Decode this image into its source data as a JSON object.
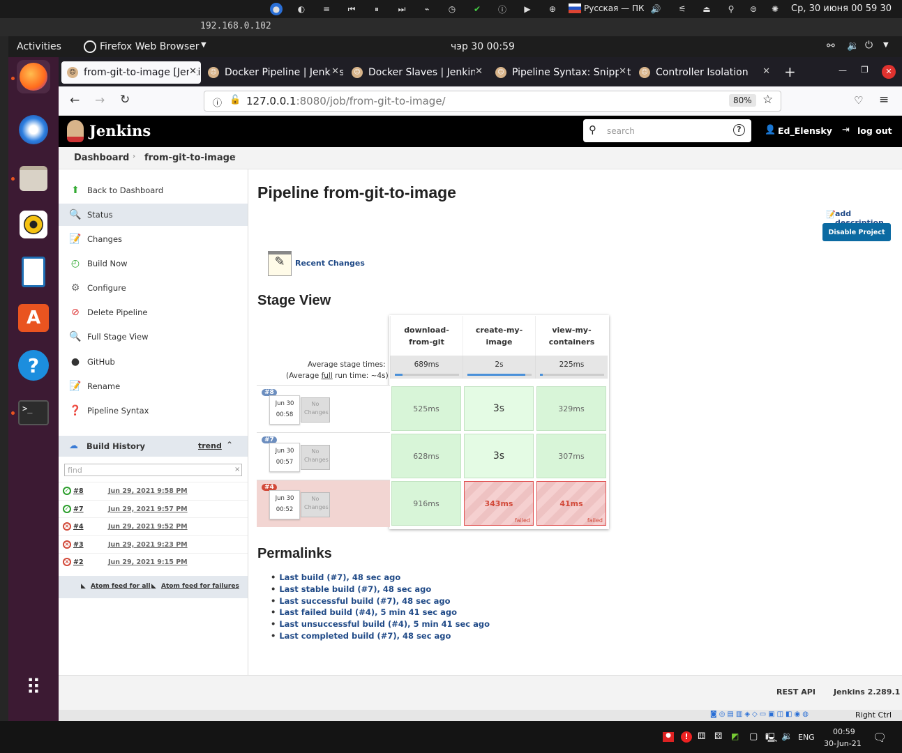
{
  "host": {
    "status_lang": "Русская — ПК",
    "datetime": "Ср, 30 июня  00 59 30",
    "vm_title": "192.168.0.102"
  },
  "gnome": {
    "activities": "Activities",
    "app_menu": "Firefox Web Browser",
    "clock": "чэр 30  00:59"
  },
  "tabs": [
    {
      "label": "from-git-to-image [Jenkins]"
    },
    {
      "label": "Docker Pipeline | Jenkins"
    },
    {
      "label": "Docker Slaves | Jenkins"
    },
    {
      "label": "Pipeline Syntax: Snippet"
    },
    {
      "label": "Controller Isolation"
    }
  ],
  "url": {
    "host": "127.0.0.1",
    "path": ":8080/job/from-git-to-image/",
    "zoom": "80%"
  },
  "jenkins": {
    "brand": "Jenkins",
    "search_placeholder": "search",
    "user": "Ed_Elensky",
    "logout": "log out",
    "crumbs": [
      "Dashboard",
      "from-git-to-image"
    ],
    "tasks": [
      "Back to Dashboard",
      "Status",
      "Changes",
      "Build Now",
      "Configure",
      "Delete Pipeline",
      "Full Stage View",
      "GitHub",
      "Rename",
      "Pipeline Syntax"
    ],
    "history": {
      "title": "Build History",
      "trend": "trend",
      "find_placeholder": "find",
      "builds": [
        {
          "num": "#8",
          "date": "Jun 29, 2021 9:58 PM",
          "status": "success"
        },
        {
          "num": "#7",
          "date": "Jun 29, 2021 9:57 PM",
          "status": "success"
        },
        {
          "num": "#4",
          "date": "Jun 29, 2021 9:52 PM",
          "status": "failed"
        },
        {
          "num": "#3",
          "date": "Jun 29, 2021 9:23 PM",
          "status": "failed"
        },
        {
          "num": "#2",
          "date": "Jun 29, 2021 9:15 PM",
          "status": "failed"
        }
      ],
      "feed_all": "Atom feed for all",
      "feed_fail": "Atom feed for failures"
    },
    "page_title": "Pipeline from-git-to-image",
    "add_description": "add description",
    "disable_button": "Disable Project",
    "recent_changes": "Recent Changes",
    "stage_view_title": "Stage View",
    "avg_label": "Average stage times:",
    "avg_full_prefix": "(Average ",
    "avg_full_word": "full",
    "avg_full_suffix": " run time: ~4s)",
    "stages": [
      {
        "name": "download-from-git",
        "avg": "689ms",
        "avg_fraction": 0.12
      },
      {
        "name": "create-my-image",
        "avg": "2s",
        "avg_fraction": 0.9
      },
      {
        "name": "view-my-containers",
        "avg": "225ms",
        "avg_fraction": 0.04
      }
    ],
    "runs": [
      {
        "badge": "#8",
        "date": "Jun 30",
        "time": "00:58",
        "changes": "No Changes",
        "failed": false,
        "cells": [
          {
            "t": "525ms",
            "s": "ok"
          },
          {
            "t": "3s",
            "s": "okb"
          },
          {
            "t": "329ms",
            "s": "ok"
          }
        ]
      },
      {
        "badge": "#7",
        "date": "Jun 30",
        "time": "00:57",
        "changes": "No Changes",
        "failed": false,
        "cells": [
          {
            "t": "628ms",
            "s": "ok"
          },
          {
            "t": "3s",
            "s": "okb"
          },
          {
            "t": "307ms",
            "s": "ok"
          }
        ]
      },
      {
        "badge": "#4",
        "date": "Jun 30",
        "time": "00:52",
        "changes": "No Changes",
        "failed": true,
        "cells": [
          {
            "t": "916ms",
            "s": "ok"
          },
          {
            "t": "343ms",
            "s": "fail"
          },
          {
            "t": "41ms",
            "s": "fail"
          }
        ]
      }
    ],
    "failed_label": "failed",
    "permalinks_title": "Permalinks",
    "permalinks": [
      "Last build (#7), 48 sec ago",
      "Last stable build (#7), 48 sec ago",
      "Last successful build (#7), 48 sec ago",
      "Last failed build (#4), 5 min 41 sec ago",
      "Last unsuccessful build (#4), 5 min 41 sec ago",
      "Last completed build (#7), 48 sec ago"
    ],
    "rest_api": "REST API",
    "version": "Jenkins 2.289.1"
  },
  "vbox": {
    "hostkey": "Right Ctrl"
  },
  "win": {
    "lang": "ENG",
    "time": "00:59",
    "date": "30-Jun-21"
  },
  "colors": {
    "jenkins_blue": "#204a87",
    "button_blue": "#0b6aa2",
    "fail_red": "#d24939",
    "dock": "#3c1a33"
  }
}
